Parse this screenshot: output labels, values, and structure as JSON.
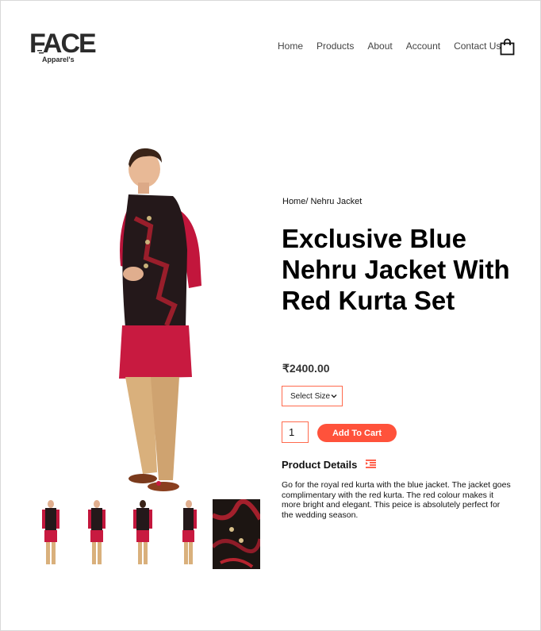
{
  "brand": {
    "name": "FACE",
    "tagline": "Apparel's"
  },
  "nav": {
    "items": [
      "Home",
      "Products",
      "About",
      "Account",
      "Contact Us"
    ]
  },
  "icons": {
    "cart": "shopping-bag-icon",
    "details": "indent-list-icon"
  },
  "colors": {
    "accent": "#ff523b",
    "border_accent": "#ff6a4d",
    "text": "#111111"
  },
  "product": {
    "breadcrumb": "Home/ Nehru Jacket",
    "title": "Exclusive Blue Nehru Jacket With Red Kurta Set",
    "price": "₹2400.00",
    "size_select": "Select Size",
    "quantity": "1",
    "add_to_cart": "Add To Cart",
    "details_heading": "Product Details",
    "description": "Go for the royal red kurta with the blue jacket. The jacket goes complimentary with the red kurta. The red colour makes it more bright and elegant. This peice is absolutely perfect for the wedding season."
  }
}
